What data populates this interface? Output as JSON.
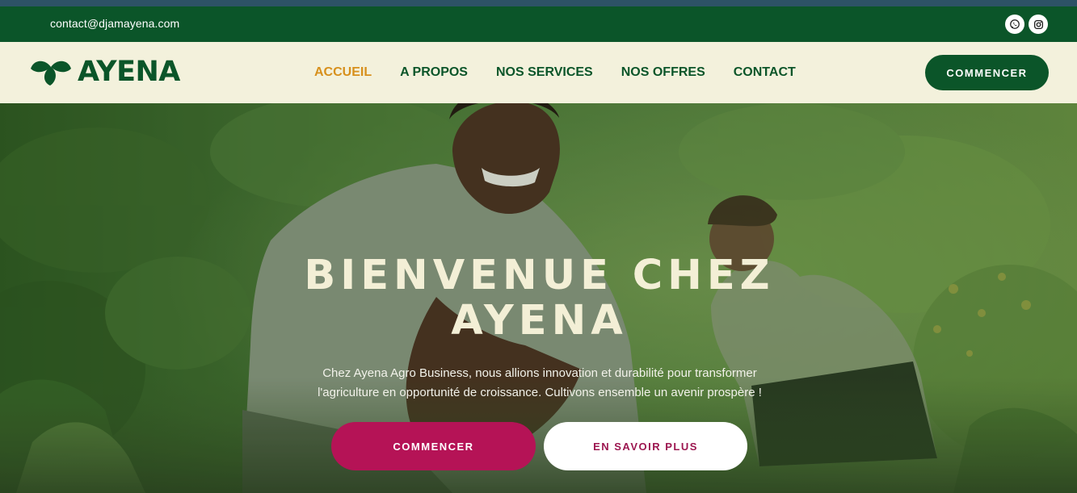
{
  "topbar": {
    "email": "contact@djamayena.com",
    "social_icons": [
      "whatsapp-icon",
      "instagram-icon"
    ]
  },
  "brand": {
    "name": "AYENA",
    "logo_icon": "leaf-logo-icon"
  },
  "nav": {
    "items": [
      {
        "label": "ACCUEIL",
        "active": true
      },
      {
        "label": "A PROPOS",
        "active": false
      },
      {
        "label": "NOS SERVICES",
        "active": false
      },
      {
        "label": "NOS OFFRES",
        "active": false
      },
      {
        "label": "CONTACT",
        "active": false
      }
    ],
    "cta_label": "COMMENCER"
  },
  "hero": {
    "title_line1": "BIENVENUE CHEZ",
    "title_line2": "AYENA",
    "text_line1": "Chez Ayena Agro Business, nous allions innovation et durabilité pour transformer",
    "text_line2": "l'agriculture en opportunité de croissance. Cultivons ensemble un avenir prospère !",
    "primary_label": "COMMENCER",
    "secondary_label": "EN SAVOIR PLUS"
  },
  "colors": {
    "dark_green": "#0b5529",
    "cream": "#f3f1dc",
    "accent_orange": "#d7901c",
    "accent_pink": "#b51356",
    "top_strip": "#2d5266"
  }
}
